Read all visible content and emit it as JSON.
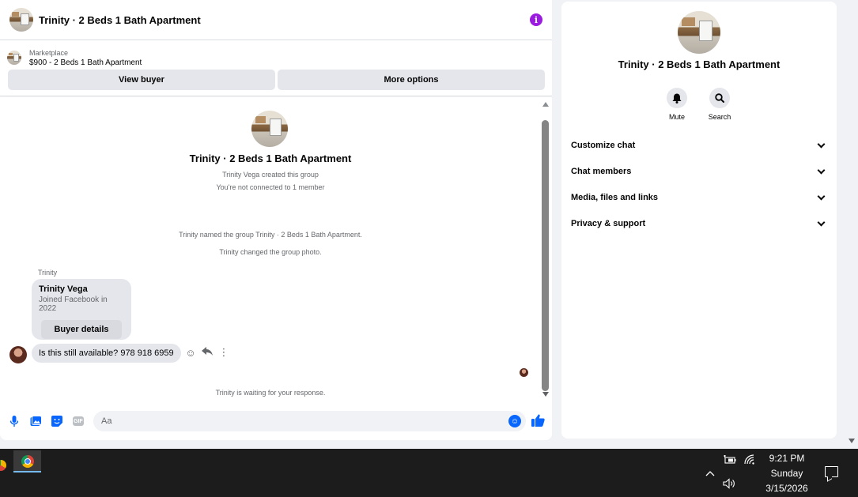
{
  "header": {
    "title": "Trinity · 2 Beds 1 Bath Apartment",
    "info_icon": "info-icon"
  },
  "marketplace": {
    "label": "Marketplace",
    "listing": "$900 - 2 Beds 1 Bath Apartment",
    "view_buyer": "View buyer",
    "more_options": "More options"
  },
  "conversation": {
    "group_name": "Trinity · 2 Beds 1 Bath Apartment",
    "created": "Trinity Vega created this group",
    "not_connected": "You're not connected to 1 member",
    "named_event": "Trinity named the group Trinity · 2 Beds 1 Bath Apartment.",
    "photo_event": "Trinity changed the group photo.",
    "sender_label": "Trinity",
    "profile_card": {
      "name": "Trinity Vega",
      "joined": "Joined Facebook in 2022",
      "button": "Buyer details"
    },
    "message": "Is this still available? 978 918 6959",
    "waiting": "Trinity is waiting for your response."
  },
  "composer": {
    "placeholder": "Aa",
    "icons": [
      "microphone-icon",
      "photo-icon",
      "sticker-icon",
      "gif-icon",
      "emoji-icon",
      "thumbs-up-icon"
    ],
    "gif_text": "GIF"
  },
  "info_panel": {
    "name": "Trinity · 2 Beds 1 Bath Apartment",
    "actions": [
      {
        "label": "Mute",
        "icon": "bell-icon"
      },
      {
        "label": "Search",
        "icon": "search-icon"
      }
    ],
    "sections": [
      "Customize chat",
      "Chat members",
      "Media, files and links",
      "Privacy & support"
    ]
  },
  "taskbar": {
    "time": "9:21 PM",
    "day": "Sunday",
    "date": "3/15/2026"
  },
  "colors": {
    "accent": "#0866ff",
    "info_purple": "#9b1be0",
    "bubble_gray": "#e4e6eb"
  }
}
